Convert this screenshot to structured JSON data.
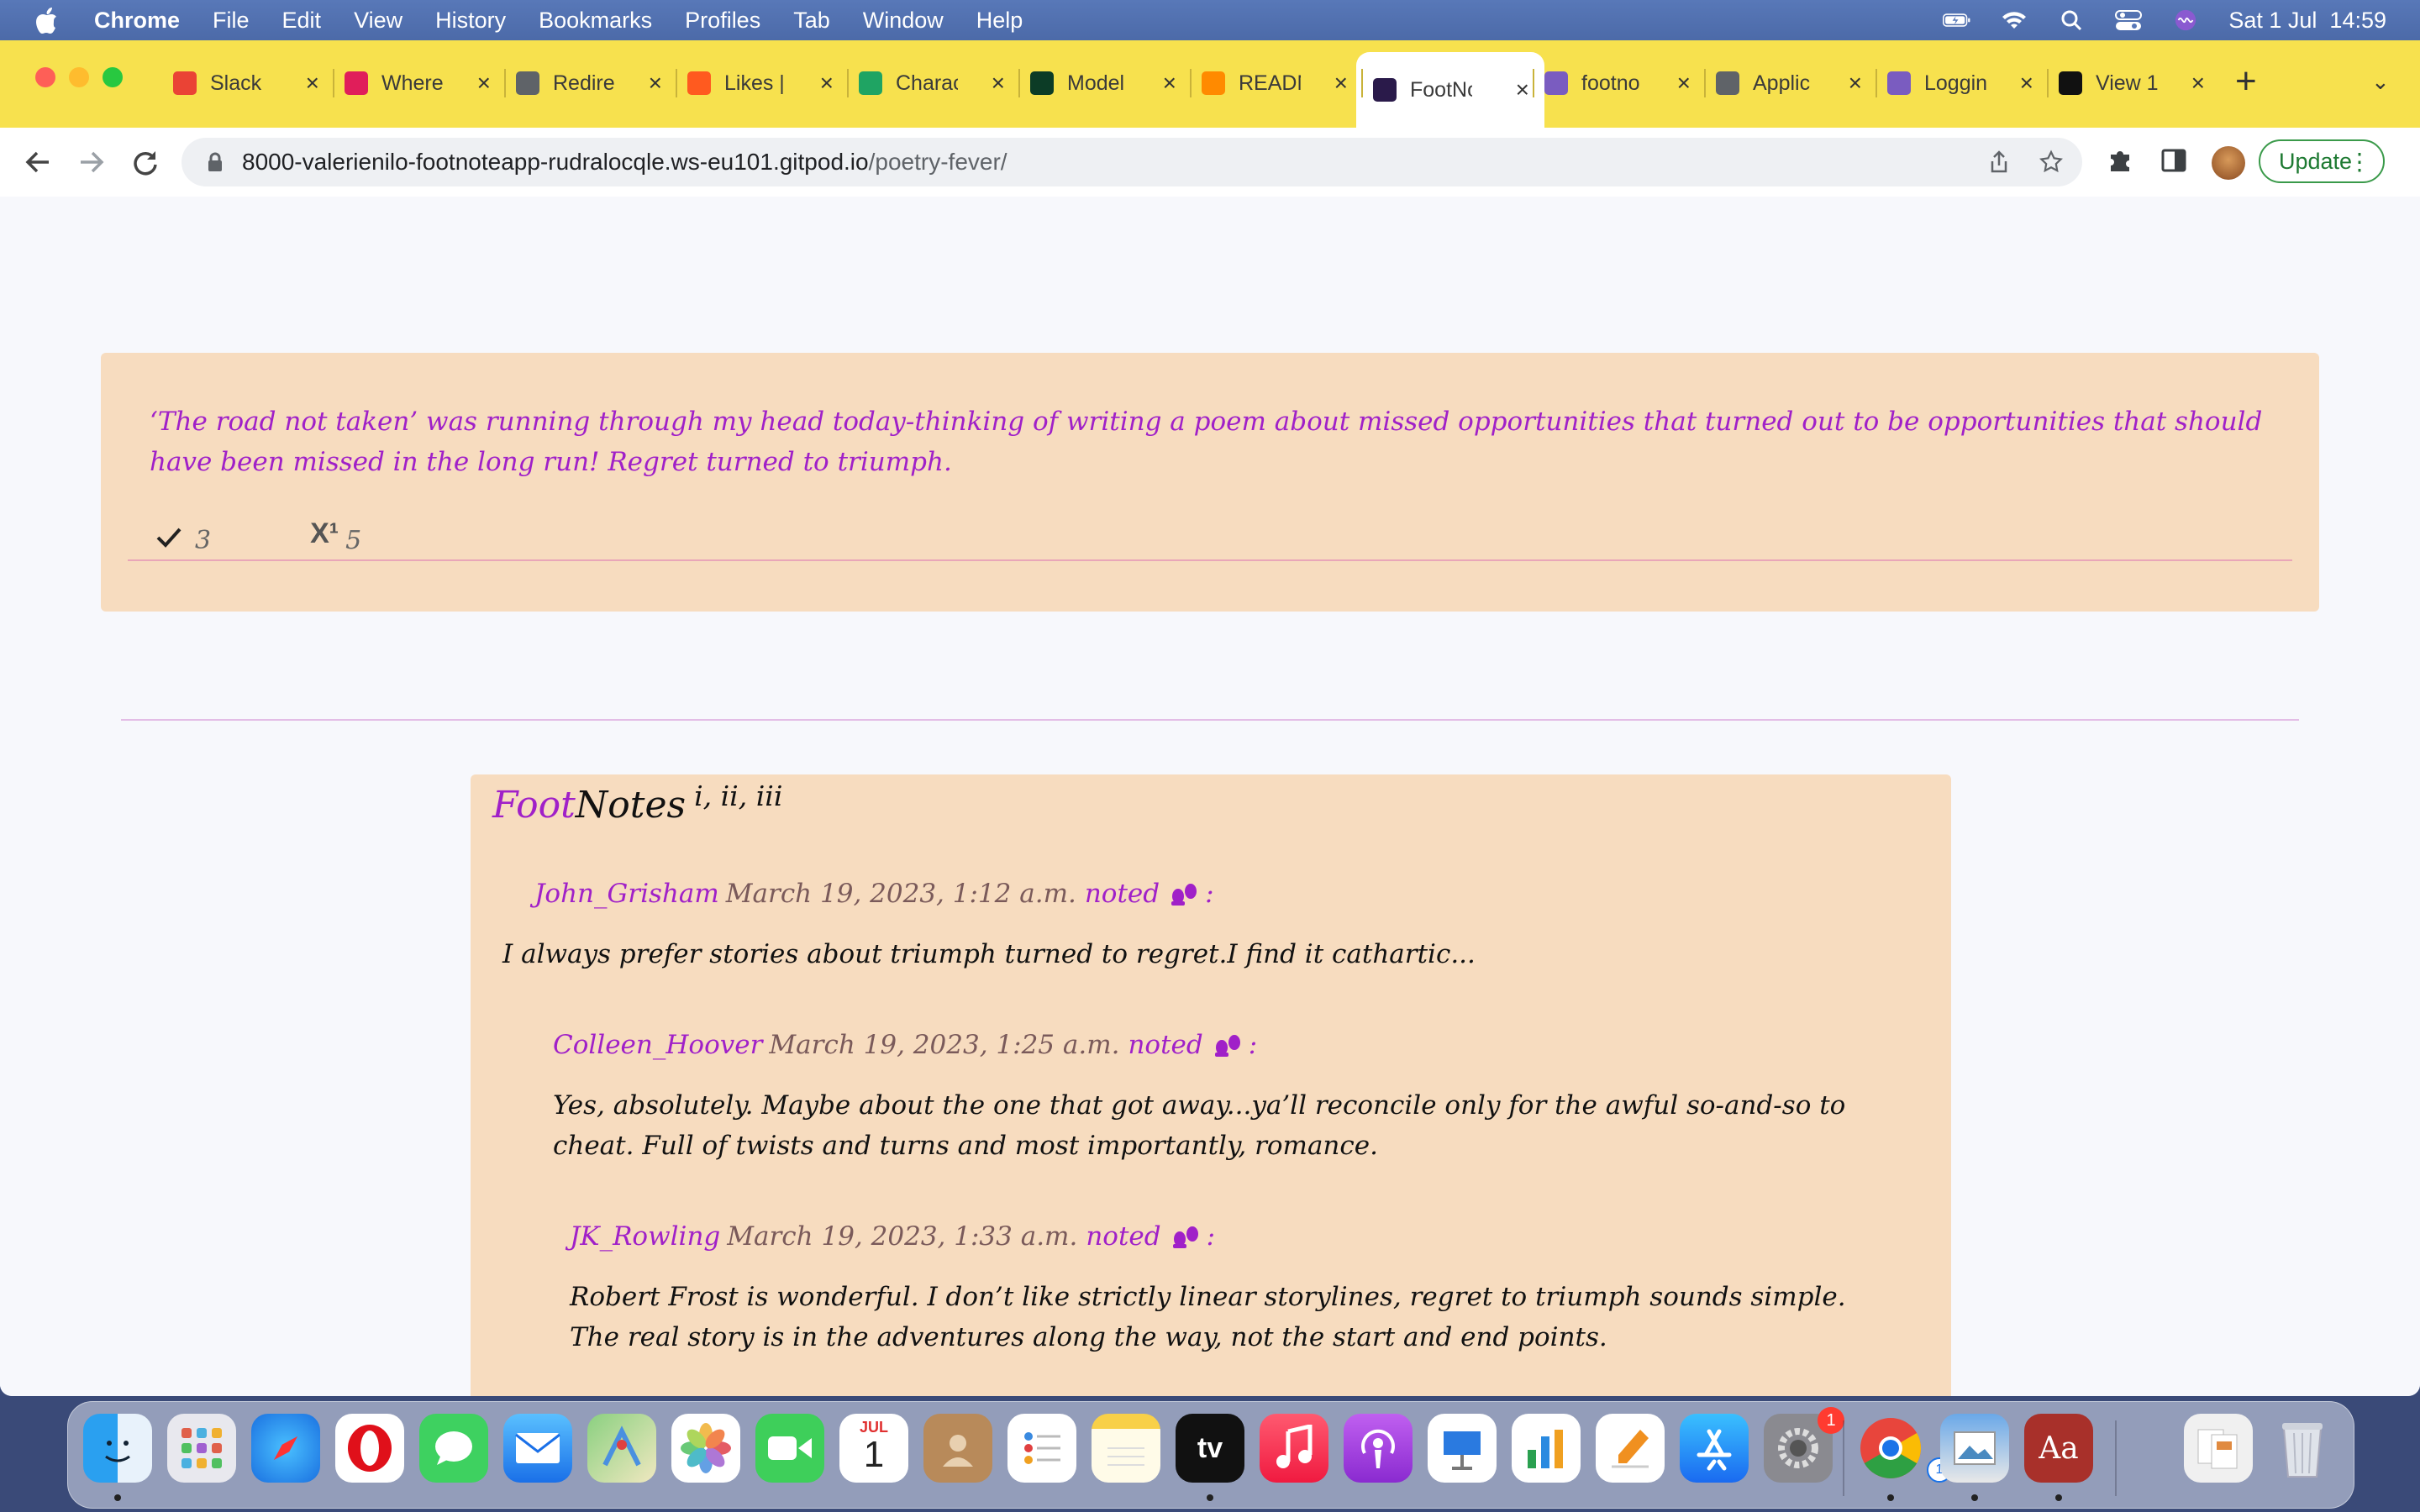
{
  "menubar": {
    "app": "Chrome",
    "items": [
      "File",
      "Edit",
      "View",
      "History",
      "Bookmarks",
      "Profiles",
      "Tab",
      "Window",
      "Help"
    ],
    "datetime": "Sat 1 Jul  14:59"
  },
  "tabs": [
    {
      "title": "Slack",
      "favicon": "gmail-icon",
      "color": "#ea4335"
    },
    {
      "title": "Where",
      "favicon": "slack-icon",
      "color": "#e01e5a"
    },
    {
      "title": "Redire",
      "favicon": "globe-icon",
      "color": "#5f6368"
    },
    {
      "title": "Likes |",
      "favicon": "opera-icon",
      "color": "#ff5a1f"
    },
    {
      "title": "Charac",
      "favicon": "drive-icon",
      "color": "#1fa463"
    },
    {
      "title": "Model",
      "favicon": "django-icon",
      "color": "#0c3c26"
    },
    {
      "title": "READM",
      "favicon": "gitpod-icon",
      "color": "#ff8a00"
    },
    {
      "title": "FootNo",
      "favicon": "footnote-icon",
      "color": "#2a1a4a",
      "active": true
    },
    {
      "title": "footno",
      "favicon": "heroku-icon",
      "color": "#7a5cc0"
    },
    {
      "title": "Applic",
      "favicon": "globe-icon",
      "color": "#5f6368"
    },
    {
      "title": "Loggin",
      "favicon": "heroku-icon",
      "color": "#7a5cc0"
    },
    {
      "title": "View 1",
      "favicon": "github-icon",
      "color": "#111111"
    }
  ],
  "address": {
    "host": "8000-valerienilo-footnoteapp-rudralocqle.ws-eu101.gitpod.io",
    "path": "/poetry-fever/"
  },
  "toolbar": {
    "update_label": "Update"
  },
  "post": {
    "text": "‘The road not taken’ was running through my head today-thinking of writing a poem about missed opportunities that turned out to be opportunities that should have been missed in the long run! Regret turned to triumph.",
    "approvals": "3",
    "footnote_mark": "X¹",
    "footnote_count": "5"
  },
  "footnotes": {
    "title_foot": "Foot",
    "title_notes": "Notes",
    "title_sup": "i, ii, iii",
    "comments": [
      {
        "user": "John_Grisham",
        "date": "March 19, 2023, 1:12 a.m.",
        "noted": "noted",
        "colon": ":",
        "text": "I always prefer stories about triumph turned to regret.I find it cathartic..."
      },
      {
        "user": "Colleen_Hoover",
        "date": "March 19, 2023, 1:25 a.m.",
        "noted": "noted",
        "colon": ":",
        "text": "Yes, absolutely. Maybe about the one that got away...ya’ll reconcile only for the awful so-and-so to cheat. Full of twists and turns and most importantly, romance."
      },
      {
        "user": "JK_Rowling",
        "date": "March 19, 2023, 1:33 a.m.",
        "noted": "noted",
        "colon": ":",
        "text": "Robert Frost is wonderful. I don’t like strictly linear storylines, regret to triumph sounds simple. The real story is in the adventures along the way, not the start and end points."
      }
    ]
  },
  "dock": {
    "calendar_month": "JUL",
    "calendar_day": "1",
    "settings_badge": "1",
    "chrome_badge": "1",
    "tv_label": "tv",
    "dictionary_label": "Aa"
  }
}
